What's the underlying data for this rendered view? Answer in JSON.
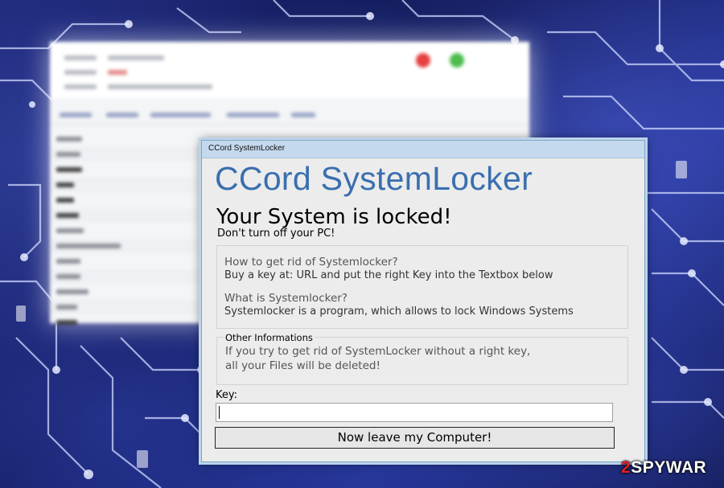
{
  "window": {
    "title_bar": "CCord SystemLocker",
    "app_title": "CCord SystemLocker",
    "headline": "Your System is locked!",
    "warning": "Don't turn off your PC!",
    "info": {
      "q1": "How to get rid of Systemlocker?",
      "a1": "Buy a key at: URL and put the right Key into the Textbox below",
      "q2": "What is Systemlocker?",
      "a2": "Systemlocker is a program, which allows to lock Windows Systems"
    },
    "other": {
      "legend": "Other Informations",
      "line1": "If you try to get rid of SystemLocker without a right key,",
      "line2": "all your Files will be deleted!"
    },
    "key_label": "Key:",
    "key_value": "",
    "button_label": "Now leave my Computer!"
  },
  "watermark": {
    "digit": "2",
    "text": "SPYWAR"
  },
  "colors": {
    "app_title": "#3a6faf",
    "title_bar": "#c4d9ee",
    "window_bg": "#ececec",
    "watermark_digit": "#e41e26"
  }
}
